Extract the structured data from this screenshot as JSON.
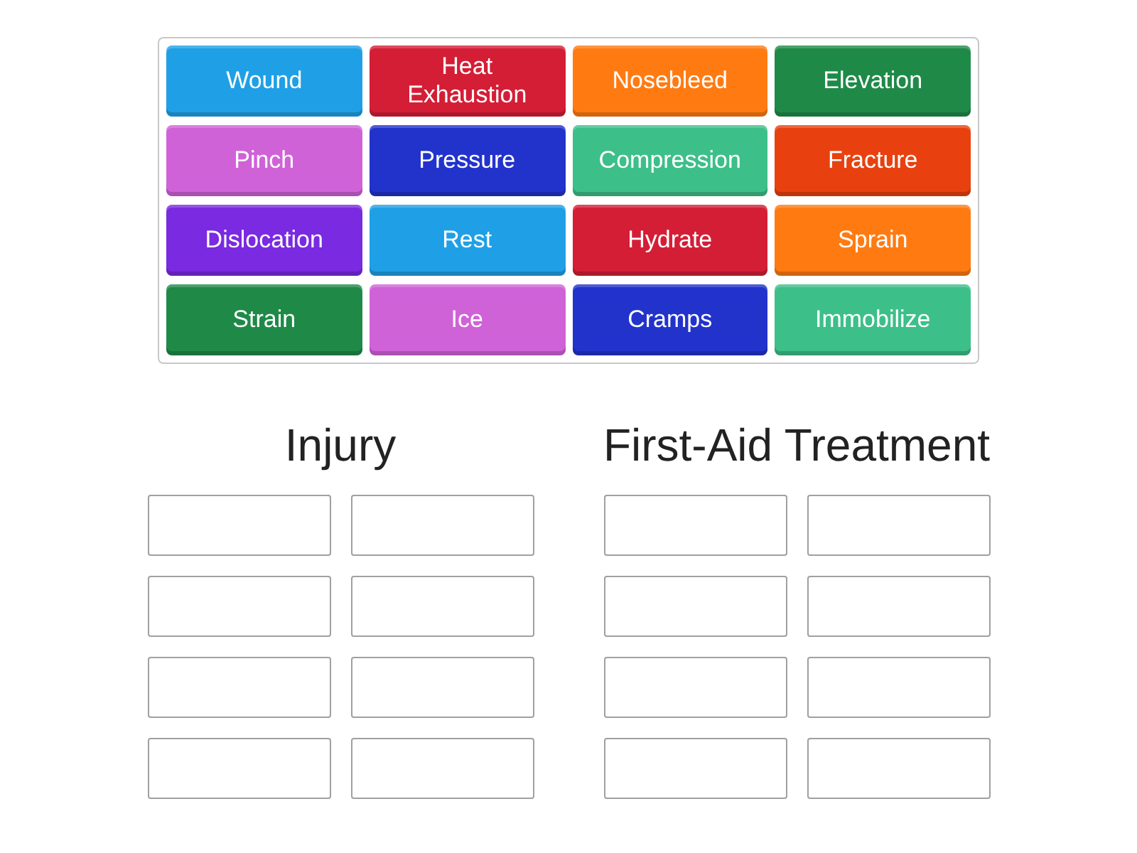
{
  "tiles": [
    {
      "label": "Wound",
      "color": "#1fa0e6"
    },
    {
      "label": "Heat Exhaustion",
      "color": "#d41e36"
    },
    {
      "label": "Nosebleed",
      "color": "#ff7b12"
    },
    {
      "label": "Elevation",
      "color": "#1f8a48"
    },
    {
      "label": "Pinch",
      "color": "#d062d8"
    },
    {
      "label": "Pressure",
      "color": "#2233cc"
    },
    {
      "label": "Compression",
      "color": "#3dbf8a"
    },
    {
      "label": "Fracture",
      "color": "#e8410f"
    },
    {
      "label": "Dislocation",
      "color": "#7a2ae0"
    },
    {
      "label": "Rest",
      "color": "#1fa0e6"
    },
    {
      "label": "Hydrate",
      "color": "#d41e36"
    },
    {
      "label": "Sprain",
      "color": "#ff7b12"
    },
    {
      "label": "Strain",
      "color": "#1f8a48"
    },
    {
      "label": "Ice",
      "color": "#d062d8"
    },
    {
      "label": "Cramps",
      "color": "#2233cc"
    },
    {
      "label": "Immobilize",
      "color": "#3dbf8a"
    }
  ],
  "groups": [
    {
      "heading": "Injury"
    },
    {
      "heading": "First-Aid Treatment"
    }
  ]
}
